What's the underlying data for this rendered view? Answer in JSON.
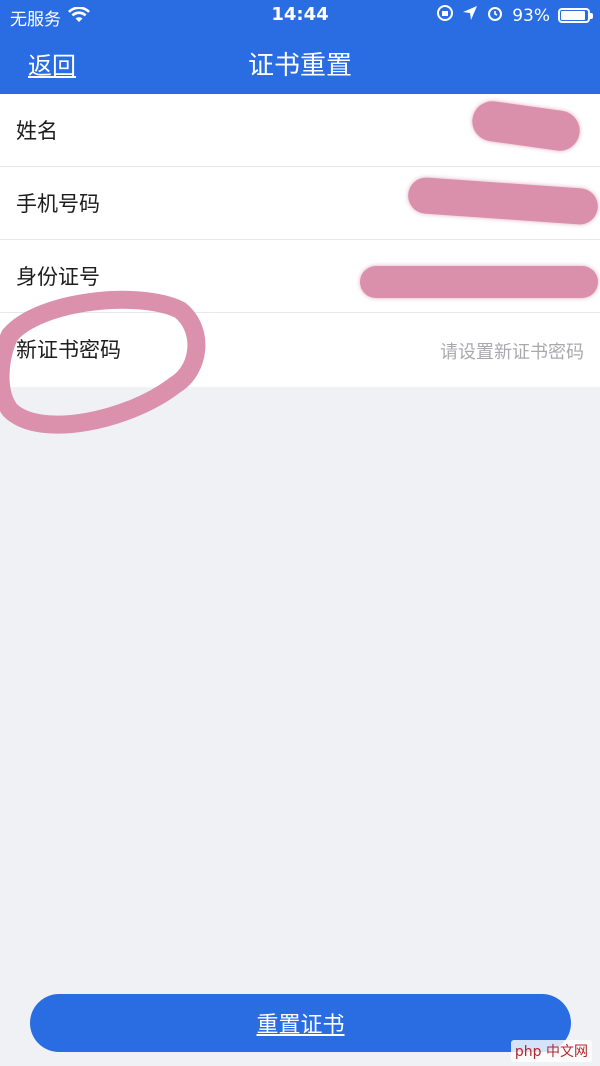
{
  "status": {
    "carrier": "无服务",
    "time": "14:44",
    "battery_percent": "93%",
    "battery_level": 0.93
  },
  "navbar": {
    "back_label": "返回",
    "title": "证书重置"
  },
  "form": {
    "rows": [
      {
        "label": "姓名",
        "value": "",
        "redacted": true
      },
      {
        "label": "手机号码",
        "value": "",
        "redacted": true
      },
      {
        "label": "身份证号",
        "value": "",
        "redacted": true
      },
      {
        "label": "新证书密码",
        "value": "",
        "placeholder": "请设置新证书密码",
        "highlighted": true
      }
    ]
  },
  "action": {
    "reset_label": "重置证书"
  },
  "watermark": "php 中文网",
  "colors": {
    "accent": "#2a6de3",
    "background": "#eff1f4",
    "scribble": "#d98aa6"
  },
  "icons": [
    "wifi-icon",
    "rotation-lock-icon",
    "location-icon",
    "alarm-icon",
    "battery-icon"
  ]
}
